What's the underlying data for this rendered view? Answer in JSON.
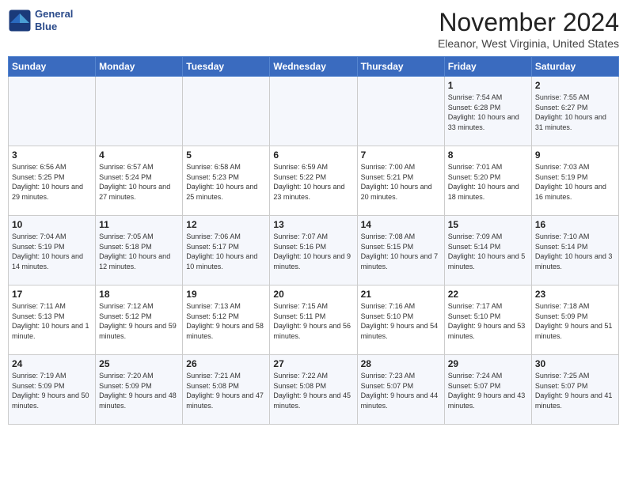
{
  "header": {
    "logo_line1": "General",
    "logo_line2": "Blue",
    "month": "November 2024",
    "location": "Eleanor, West Virginia, United States"
  },
  "days_of_week": [
    "Sunday",
    "Monday",
    "Tuesday",
    "Wednesday",
    "Thursday",
    "Friday",
    "Saturday"
  ],
  "weeks": [
    [
      {
        "day": "",
        "info": ""
      },
      {
        "day": "",
        "info": ""
      },
      {
        "day": "",
        "info": ""
      },
      {
        "day": "",
        "info": ""
      },
      {
        "day": "",
        "info": ""
      },
      {
        "day": "1",
        "info": "Sunrise: 7:54 AM\nSunset: 6:28 PM\nDaylight: 10 hours and 33 minutes."
      },
      {
        "day": "2",
        "info": "Sunrise: 7:55 AM\nSunset: 6:27 PM\nDaylight: 10 hours and 31 minutes."
      }
    ],
    [
      {
        "day": "3",
        "info": "Sunrise: 6:56 AM\nSunset: 5:25 PM\nDaylight: 10 hours and 29 minutes."
      },
      {
        "day": "4",
        "info": "Sunrise: 6:57 AM\nSunset: 5:24 PM\nDaylight: 10 hours and 27 minutes."
      },
      {
        "day": "5",
        "info": "Sunrise: 6:58 AM\nSunset: 5:23 PM\nDaylight: 10 hours and 25 minutes."
      },
      {
        "day": "6",
        "info": "Sunrise: 6:59 AM\nSunset: 5:22 PM\nDaylight: 10 hours and 23 minutes."
      },
      {
        "day": "7",
        "info": "Sunrise: 7:00 AM\nSunset: 5:21 PM\nDaylight: 10 hours and 20 minutes."
      },
      {
        "day": "8",
        "info": "Sunrise: 7:01 AM\nSunset: 5:20 PM\nDaylight: 10 hours and 18 minutes."
      },
      {
        "day": "9",
        "info": "Sunrise: 7:03 AM\nSunset: 5:19 PM\nDaylight: 10 hours and 16 minutes."
      }
    ],
    [
      {
        "day": "10",
        "info": "Sunrise: 7:04 AM\nSunset: 5:19 PM\nDaylight: 10 hours and 14 minutes."
      },
      {
        "day": "11",
        "info": "Sunrise: 7:05 AM\nSunset: 5:18 PM\nDaylight: 10 hours and 12 minutes."
      },
      {
        "day": "12",
        "info": "Sunrise: 7:06 AM\nSunset: 5:17 PM\nDaylight: 10 hours and 10 minutes."
      },
      {
        "day": "13",
        "info": "Sunrise: 7:07 AM\nSunset: 5:16 PM\nDaylight: 10 hours and 9 minutes."
      },
      {
        "day": "14",
        "info": "Sunrise: 7:08 AM\nSunset: 5:15 PM\nDaylight: 10 hours and 7 minutes."
      },
      {
        "day": "15",
        "info": "Sunrise: 7:09 AM\nSunset: 5:14 PM\nDaylight: 10 hours and 5 minutes."
      },
      {
        "day": "16",
        "info": "Sunrise: 7:10 AM\nSunset: 5:14 PM\nDaylight: 10 hours and 3 minutes."
      }
    ],
    [
      {
        "day": "17",
        "info": "Sunrise: 7:11 AM\nSunset: 5:13 PM\nDaylight: 10 hours and 1 minute."
      },
      {
        "day": "18",
        "info": "Sunrise: 7:12 AM\nSunset: 5:12 PM\nDaylight: 9 hours and 59 minutes."
      },
      {
        "day": "19",
        "info": "Sunrise: 7:13 AM\nSunset: 5:12 PM\nDaylight: 9 hours and 58 minutes."
      },
      {
        "day": "20",
        "info": "Sunrise: 7:15 AM\nSunset: 5:11 PM\nDaylight: 9 hours and 56 minutes."
      },
      {
        "day": "21",
        "info": "Sunrise: 7:16 AM\nSunset: 5:10 PM\nDaylight: 9 hours and 54 minutes."
      },
      {
        "day": "22",
        "info": "Sunrise: 7:17 AM\nSunset: 5:10 PM\nDaylight: 9 hours and 53 minutes."
      },
      {
        "day": "23",
        "info": "Sunrise: 7:18 AM\nSunset: 5:09 PM\nDaylight: 9 hours and 51 minutes."
      }
    ],
    [
      {
        "day": "24",
        "info": "Sunrise: 7:19 AM\nSunset: 5:09 PM\nDaylight: 9 hours and 50 minutes."
      },
      {
        "day": "25",
        "info": "Sunrise: 7:20 AM\nSunset: 5:09 PM\nDaylight: 9 hours and 48 minutes."
      },
      {
        "day": "26",
        "info": "Sunrise: 7:21 AM\nSunset: 5:08 PM\nDaylight: 9 hours and 47 minutes."
      },
      {
        "day": "27",
        "info": "Sunrise: 7:22 AM\nSunset: 5:08 PM\nDaylight: 9 hours and 45 minutes."
      },
      {
        "day": "28",
        "info": "Sunrise: 7:23 AM\nSunset: 5:07 PM\nDaylight: 9 hours and 44 minutes."
      },
      {
        "day": "29",
        "info": "Sunrise: 7:24 AM\nSunset: 5:07 PM\nDaylight: 9 hours and 43 minutes."
      },
      {
        "day": "30",
        "info": "Sunrise: 7:25 AM\nSunset: 5:07 PM\nDaylight: 9 hours and 41 minutes."
      }
    ]
  ]
}
